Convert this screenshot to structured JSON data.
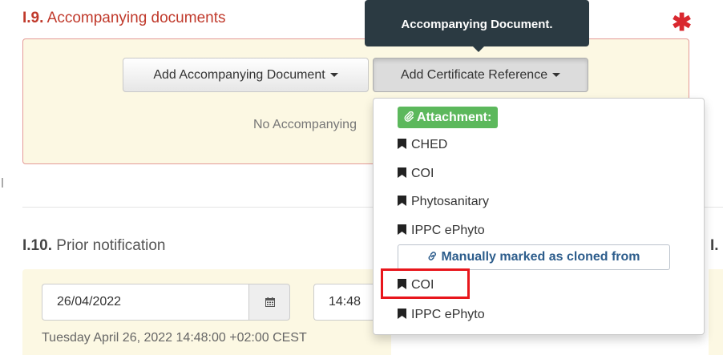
{
  "section9": {
    "number": "I.9.",
    "title": "Accompanying documents",
    "add_document_label": "Add Accompanying Document",
    "add_certificate_label": "Add Certificate Reference",
    "empty_text": "No Accompanying"
  },
  "tooltip": {
    "line2": "Accompanying Document."
  },
  "menu": {
    "attachment_label": "Attachment:",
    "attachment_items": [
      "CHED",
      "COI",
      "Phytosanitary",
      "IPPC ePhyto"
    ],
    "cloned_label": "Manually marked as cloned from",
    "cloned_items": [
      "COI",
      "IPPC ePhyto"
    ],
    "highlighted_item": "COI"
  },
  "section10": {
    "number": "I.10.",
    "title": "Prior notification",
    "date_value": "26/04/2022",
    "time_value": "14:48",
    "date_long": "Tuesday April 26, 2022 14:48:00 +02:00 CEST"
  },
  "section11": {
    "number_partial": "I."
  },
  "colors": {
    "accent_red": "#d9282f",
    "panel_bg": "#fcf8e3",
    "label_green": "#5cb85c",
    "tooltip_bg": "#2b3a42"
  }
}
